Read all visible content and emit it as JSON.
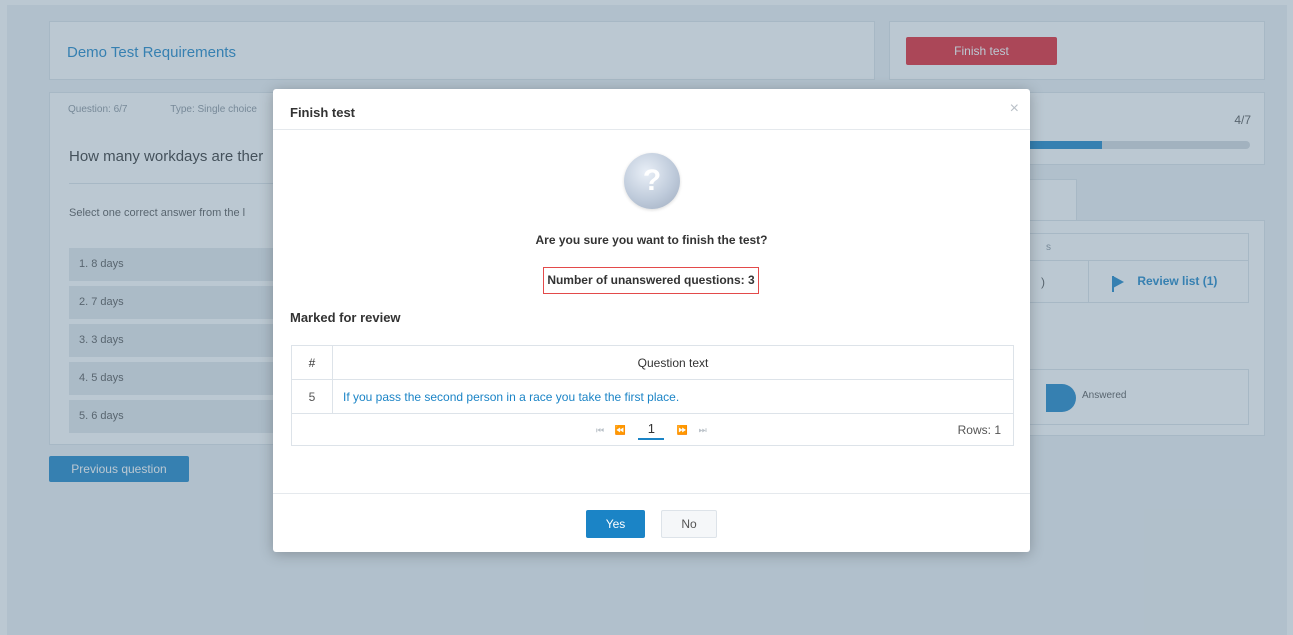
{
  "header": {
    "title": "Demo Test Requirements",
    "finish_label": "Finish test"
  },
  "question": {
    "number_label": "Question: 6/7",
    "type_label": "Type: Single choice",
    "text": "How many workdays are ther",
    "instruction": "Select one correct answer from the l",
    "answers": [
      "1.  8 days",
      "2.  7 days",
      "3.  3 days",
      "4.  5 days",
      "5.  6 days"
    ]
  },
  "nav": {
    "previous_label": "Previous question"
  },
  "progress": {
    "count": "4/7",
    "fraction": 0.5714
  },
  "status": {
    "header_fragment": "s",
    "cell_fragment": ")",
    "review_list_label": "Review list (1)",
    "legend_answered": "Answered"
  },
  "modal": {
    "title": "Finish test",
    "close_glyph": "×",
    "icon_glyph": "?",
    "confirm_text": "Are you sure you want to finish the test?",
    "unanswered_text": "Number of unanswered questions: 3",
    "review_heading": "Marked for review",
    "table": {
      "headers": [
        "#",
        "Question text"
      ],
      "rows": [
        {
          "num": "5",
          "text": "If you pass the second person in a race you take the first place."
        }
      ],
      "pager": {
        "first": "⏮",
        "prev": "⏪",
        "current": "1",
        "next": "⏩",
        "last": "⏭"
      },
      "rows_label": "Rows: 1"
    },
    "yes_label": "Yes",
    "no_label": "No"
  }
}
